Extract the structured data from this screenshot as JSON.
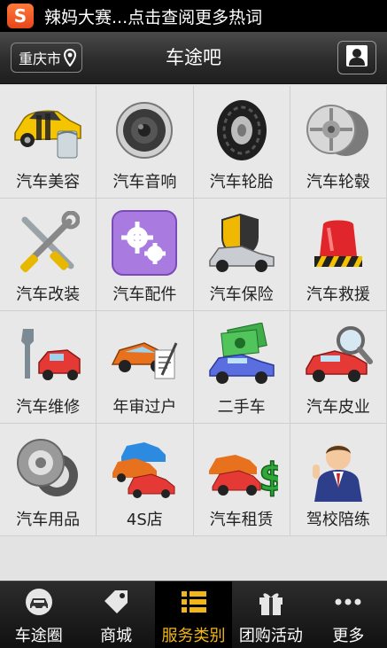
{
  "notification": {
    "app_icon": "S",
    "text": "辣妈大赛...点击查阅更多热词"
  },
  "header": {
    "city_label": "重庆市",
    "title": "车途吧"
  },
  "services": [
    {
      "label": "汽车美容",
      "icon": "car-beauty-icon"
    },
    {
      "label": "汽车音响",
      "icon": "speaker-icon"
    },
    {
      "label": "汽车轮胎",
      "icon": "tire-icon"
    },
    {
      "label": "汽车轮毂",
      "icon": "wheel-hub-icon"
    },
    {
      "label": "汽车改装",
      "icon": "tools-icon"
    },
    {
      "label": "汽车配件",
      "icon": "gears-icon"
    },
    {
      "label": "汽车保险",
      "icon": "shield-car-icon"
    },
    {
      "label": "汽车救援",
      "icon": "siren-icon"
    },
    {
      "label": "汽车维修",
      "icon": "wrench-car-icon"
    },
    {
      "label": "年审过户",
      "icon": "inspection-car-icon"
    },
    {
      "label": "二手车",
      "icon": "money-car-icon"
    },
    {
      "label": "汽车皮业",
      "icon": "magnifier-car-icon"
    },
    {
      "label": "汽车用品",
      "icon": "gear-ring-icon"
    },
    {
      "label": "4S店",
      "icon": "multi-car-icon"
    },
    {
      "label": "汽车租赁",
      "icon": "dollar-car-icon"
    },
    {
      "label": "驾校陪练",
      "icon": "instructor-icon"
    }
  ],
  "bottom_nav": [
    {
      "label": "车途圈",
      "icon": "car-circle-icon",
      "active": false
    },
    {
      "label": "商城",
      "icon": "tag-icon",
      "active": false
    },
    {
      "label": "服务类别",
      "icon": "list-icon",
      "active": true
    },
    {
      "label": "团购活动",
      "icon": "gift-icon",
      "active": false
    },
    {
      "label": "更多",
      "icon": "more-dots-icon",
      "active": false
    }
  ],
  "colors": {
    "active_tab": "#f3b619",
    "header_bg": "#2c2c2c"
  }
}
